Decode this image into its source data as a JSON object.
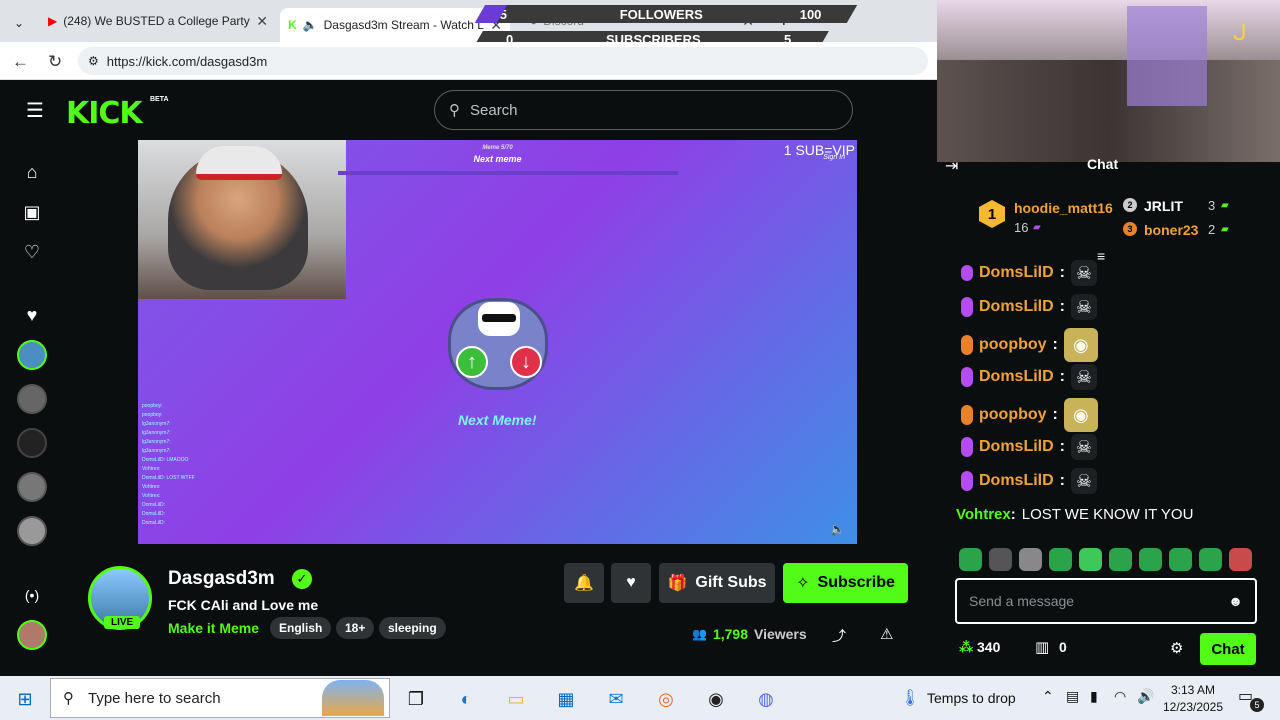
{
  "tabs": [
    {
      "label": "(248) We BUSTED a College Party!",
      "icon": "youtube-icon"
    },
    {
      "label": "Dasgasd3m Stream - Watch L",
      "icon": "kick-icon"
    },
    {
      "label": "Discord",
      "icon": "discord-icon"
    }
  ],
  "overlay": {
    "followers_label": "FOLLOWERS",
    "followers_current": "5",
    "followers_goal": "100",
    "subscribers_label": "SUBSCRIBERS",
    "subscribers_current": "0",
    "subscribers_goal": "5"
  },
  "address": {
    "url": "https://kick.com/dasgasd3m"
  },
  "header": {
    "logo": "KICK",
    "beta": "BETA",
    "search_placeholder": "Search"
  },
  "video": {
    "meme_counter": "Meme 5/70",
    "meme_title": "Next meme",
    "vip_text": "1 SUB=VIP",
    "sign_in": "Sign In",
    "next_meme": "Next Meme!",
    "mini_chat": [
      "poopboy:",
      "poopboy:",
      "lg3anonym7:",
      "lg3anonym7:",
      "lg3anonym7:",
      "lg3anonym7:",
      "DomsLilD: LMAOOO",
      "Vohtrex:",
      "DomsLilD: LOST WTFF",
      "Vohtrex:",
      "Vohtrex:",
      "DomsLilD:",
      "DomsLilD:",
      "DomsLilD:"
    ]
  },
  "channel": {
    "name": "Dasgasd3m",
    "live": "LIVE",
    "title": "FCK CAli and Love me",
    "category": "Make it Meme",
    "tags": [
      "English",
      "18+",
      "sleeping"
    ],
    "gift_label": "Gift Subs",
    "subscribe_label": "Subscribe",
    "viewers": "1,798",
    "viewers_label": "Viewers"
  },
  "chat": {
    "header": "Chat",
    "top_gifters": [
      {
        "rank": "1",
        "name": "hoodie_matt16",
        "count": "16"
      },
      {
        "rank": "2",
        "name": "JRLIT",
        "count": "3"
      },
      {
        "rank": "3",
        "name": "boner23",
        "count": "2"
      }
    ],
    "messages": [
      {
        "user": "DomsLilD",
        "color": "#f0a23a",
        "badge": "#b44cf0",
        "emote": "skull"
      },
      {
        "user": "DomsLilD",
        "color": "#f0a23a",
        "badge": "#b44cf0",
        "emote": "skull"
      },
      {
        "user": "poopboy",
        "color": "#f0a23a",
        "badge": "#e8822a",
        "emote": "minion"
      },
      {
        "user": "DomsLilD",
        "color": "#f0a23a",
        "badge": "#b44cf0",
        "emote": "skull"
      },
      {
        "user": "poopboy",
        "color": "#f0a23a",
        "badge": "#e8822a",
        "emote": "minion"
      },
      {
        "user": "DomsLilD",
        "color": "#f0a23a",
        "badge": "#b44cf0",
        "emote": "skull"
      },
      {
        "user": "DomsLilD",
        "color": "#f0a23a",
        "badge": "#b44cf0",
        "emote": "skull"
      }
    ],
    "last_message": {
      "user": "Vohtrex",
      "text": "LOST WE KNOW IT YOU"
    },
    "input_placeholder": "Send a message",
    "points": "340",
    "gifts": "0",
    "send_label": "Chat"
  },
  "taskbar": {
    "search_placeholder": "Type here to search",
    "weather": "Temps to drop",
    "time": "3:13 AM",
    "date": "12/23/2025",
    "notifications": "5"
  },
  "colors": {
    "accent": "#53fc18",
    "background": "#0b0e0f"
  }
}
